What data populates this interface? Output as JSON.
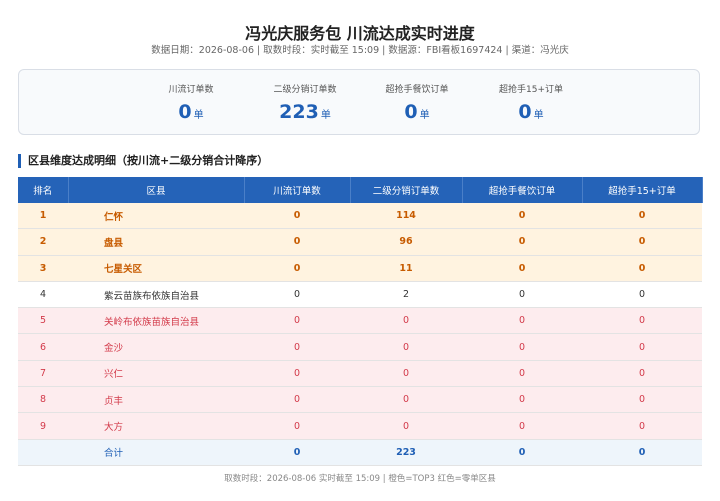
{
  "header": {
    "title": "冯光庆服务包 川流达成实时进度",
    "meta": "数据日期：2026-08-06 | 取数时段：实时截至 15:09 | 数据源：FBI看板1697424 | 渠道：冯光庆"
  },
  "summary": [
    {
      "label": "川流订单数",
      "value": "0",
      "unit": "单"
    },
    {
      "label": "二级分销订单数",
      "value": "223",
      "unit": "单"
    },
    {
      "label": "超抢手餐饮订单",
      "value": "0",
      "unit": "单"
    },
    {
      "label": "超抢手15+订单",
      "value": "0",
      "unit": "单"
    }
  ],
  "section": {
    "title": "区县维度达成明细（按川流+二级分销合计降序）"
  },
  "table": {
    "headers": [
      "排名",
      "区县",
      "川流订单数",
      "二级分销订单数",
      "超抢手餐饮订单",
      "超抢手15+订单"
    ],
    "rows": [
      {
        "rank": "1",
        "name": "仁怀",
        "chuanliu": "0",
        "fenxiao": "114",
        "canyin": "0",
        "plus15": "0",
        "style": "top"
      },
      {
        "rank": "2",
        "name": "盘县",
        "chuanliu": "0",
        "fenxiao": "96",
        "canyin": "0",
        "plus15": "0",
        "style": "top"
      },
      {
        "rank": "3",
        "name": "七星关区",
        "chuanliu": "0",
        "fenxiao": "11",
        "canyin": "0",
        "plus15": "0",
        "style": "top"
      },
      {
        "rank": "4",
        "name": "紫云苗族布依族自治县",
        "chuanliu": "0",
        "fenxiao": "2",
        "canyin": "0",
        "plus15": "0",
        "style": "normal"
      },
      {
        "rank": "5",
        "name": "关岭布依族苗族自治县",
        "chuanliu": "0",
        "fenxiao": "0",
        "canyin": "0",
        "plus15": "0",
        "style": "zero"
      },
      {
        "rank": "6",
        "name": "金沙",
        "chuanliu": "0",
        "fenxiao": "0",
        "canyin": "0",
        "plus15": "0",
        "style": "zero"
      },
      {
        "rank": "7",
        "name": "兴仁",
        "chuanliu": "0",
        "fenxiao": "0",
        "canyin": "0",
        "plus15": "0",
        "style": "zero"
      },
      {
        "rank": "8",
        "name": "贞丰",
        "chuanliu": "0",
        "fenxiao": "0",
        "canyin": "0",
        "plus15": "0",
        "style": "zero"
      },
      {
        "rank": "9",
        "name": "大方",
        "chuanliu": "0",
        "fenxiao": "0",
        "canyin": "0",
        "plus15": "0",
        "style": "zero"
      }
    ],
    "total": {
      "label": "合计",
      "chuanliu": "0",
      "fenxiao": "223",
      "canyin": "0",
      "plus15": "0"
    }
  },
  "footer": "取数时段：2026-08-06 实时截至 15:09 | 橙色=TOP3 红色=零单区县"
}
